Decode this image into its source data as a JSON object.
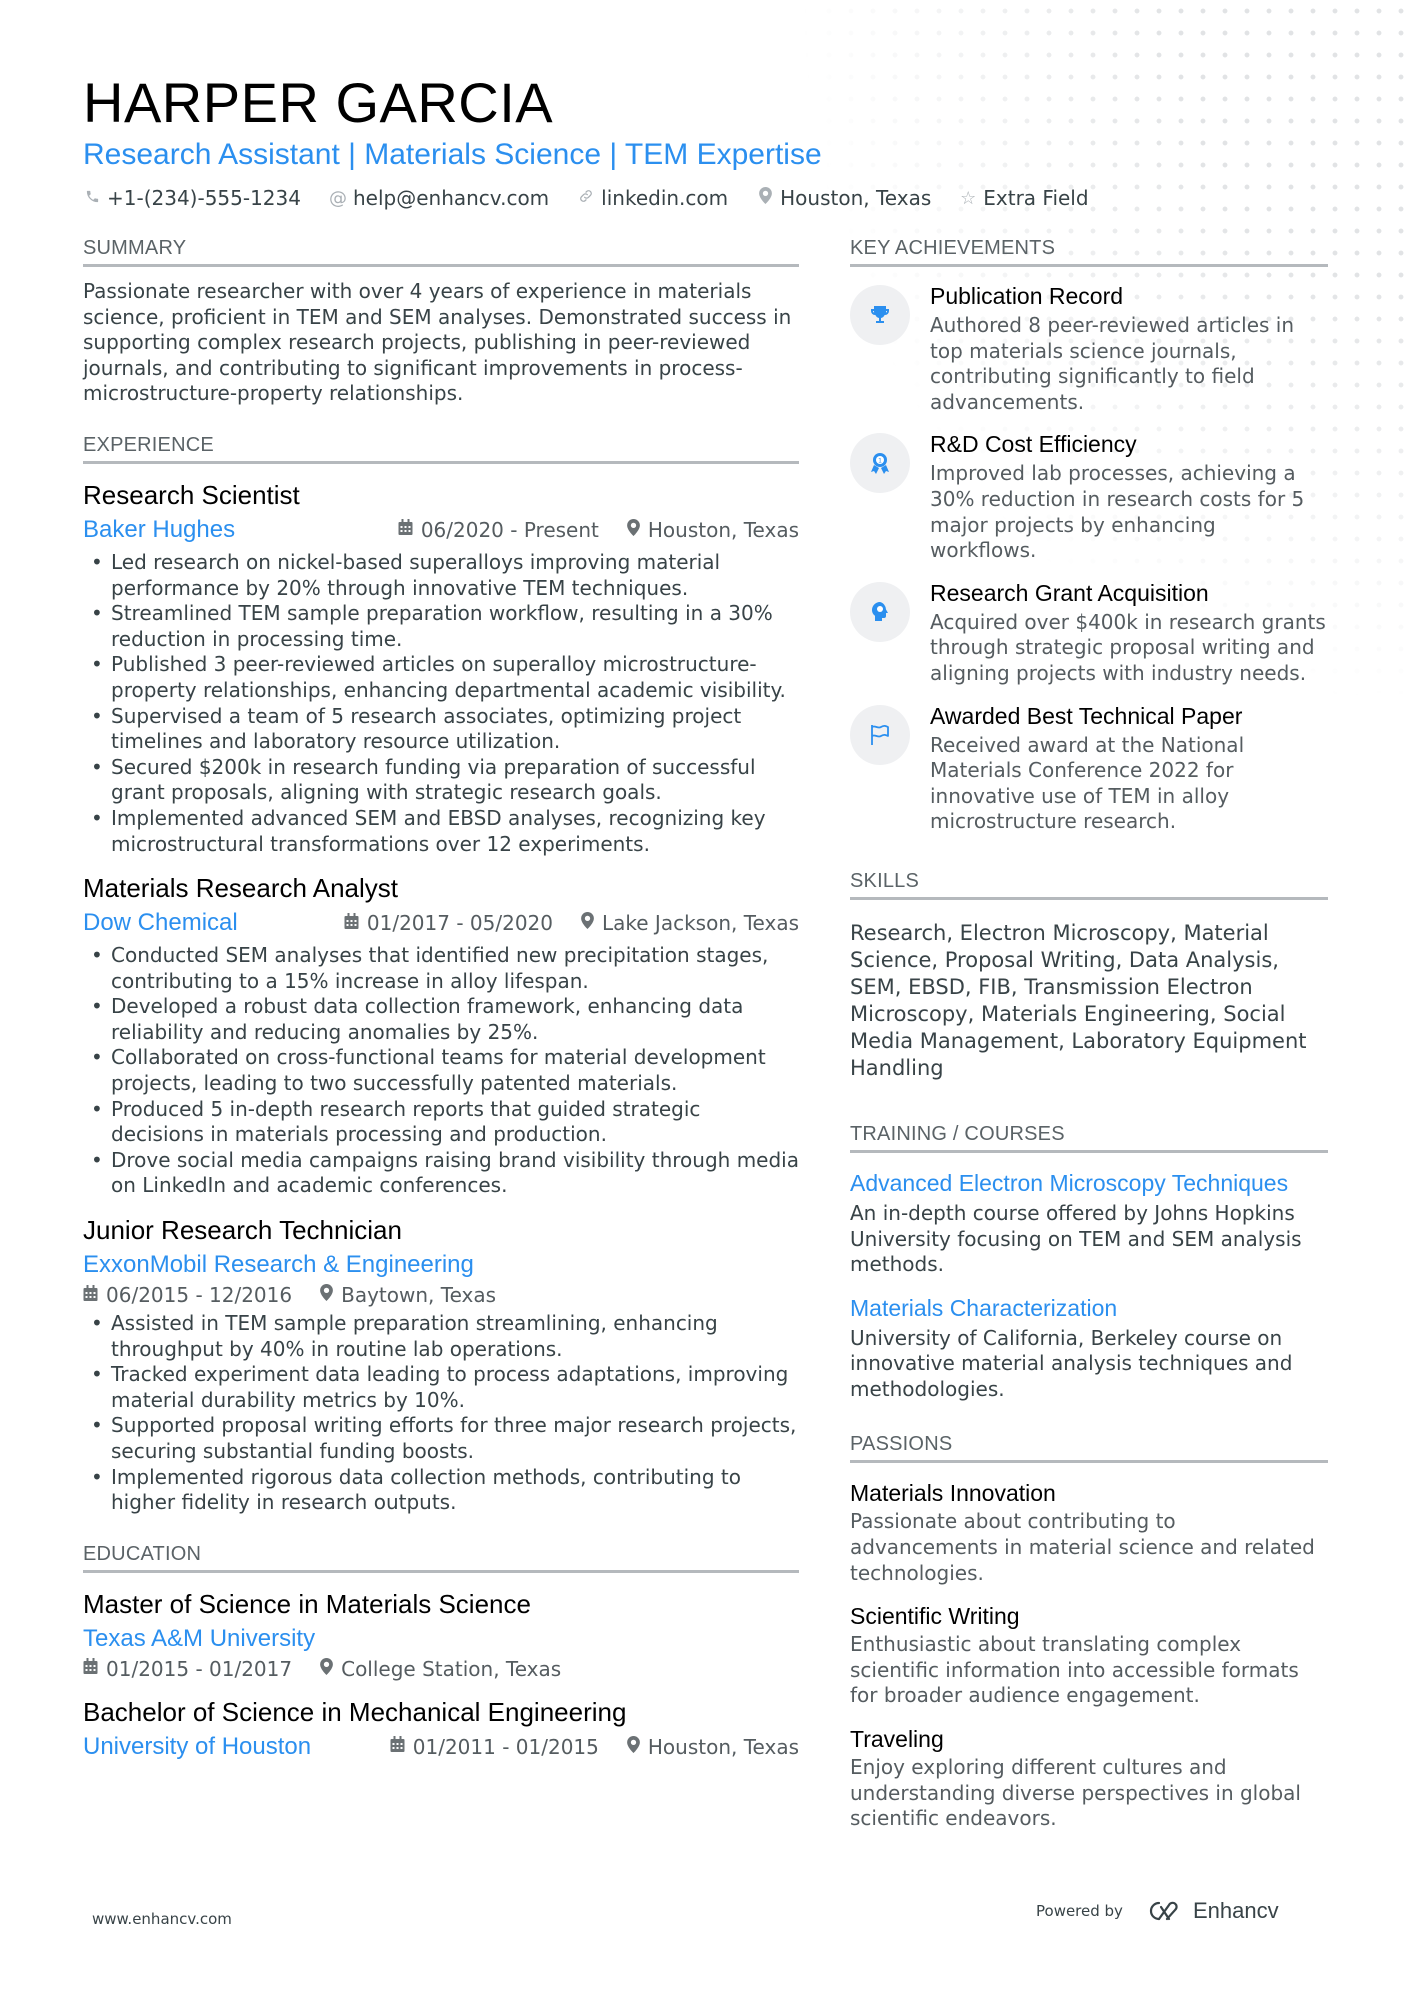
{
  "header": {
    "name": "HARPER GARCIA",
    "title": "Research Assistant | Materials Science | TEM Expertise",
    "contacts": [
      {
        "icon": "phone-icon",
        "glyph": "✆",
        "text": "+1-(234)-555-1234"
      },
      {
        "icon": "at-icon",
        "glyph": "@",
        "text": "help@enhancv.com"
      },
      {
        "icon": "link-icon",
        "glyph": "🔗︎",
        "text": "linkedin.com"
      },
      {
        "icon": "location-pin-icon",
        "glyph": "⚲",
        "text": "Houston, Texas"
      },
      {
        "icon": "star-icon",
        "glyph": "☆",
        "text": "Extra Field"
      }
    ]
  },
  "summary": {
    "heading": "SUMMARY",
    "text": "Passionate researcher with over 4 years of experience in materials science, proficient in TEM and SEM analyses. Demonstrated success in supporting complex research projects, publishing in peer-reviewed journals, and contributing to significant improvements in process-microstructure-property relationships."
  },
  "experience": {
    "heading": "EXPERIENCE",
    "jobs": [
      {
        "title": "Research Scientist",
        "company": "Baker Hughes",
        "dates": "06/2020 - Present",
        "location": "Houston, Texas",
        "bullets": [
          "Led research on nickel-based superalloys improving material performance by 20% through innovative TEM techniques.",
          "Streamlined TEM sample preparation workflow, resulting in a 30% reduction in processing time.",
          "Published 3 peer-reviewed articles on superalloy microstructure-property relationships, enhancing departmental academic visibility.",
          "Supervised a team of 5 research associates, optimizing project timelines and laboratory resource utilization.",
          "Secured $200k in research funding via preparation of successful grant proposals, aligning with strategic research goals.",
          "Implemented advanced SEM and EBSD analyses, recognizing key microstructural transformations over 12 experiments."
        ]
      },
      {
        "title": "Materials Research Analyst",
        "company": "Dow Chemical",
        "dates": "01/2017 - 05/2020",
        "location": "Lake Jackson, Texas",
        "bullets": [
          "Conducted SEM analyses that identified new precipitation stages, contributing to a 15% increase in alloy lifespan.",
          "Developed a robust data collection framework, enhancing data reliability and reducing anomalies by 25%.",
          "Collaborated on cross-functional teams for material development projects, leading to two successfully patented materials.",
          "Produced 5 in-depth research reports that guided strategic decisions in materials processing and production.",
          "Drove social media campaigns raising brand visibility through media on LinkedIn and academic conferences."
        ]
      },
      {
        "title": "Junior Research Technician",
        "company": "ExxonMobil Research & Engineering",
        "dates": "06/2015 - 12/2016",
        "location": "Baytown, Texas",
        "bullets": [
          "Assisted in TEM sample preparation streamlining, enhancing throughput by 40% in routine lab operations.",
          "Tracked experiment data leading to process adaptations, improving material durability metrics by 10%.",
          "Supported proposal writing efforts for three major research projects, securing substantial funding boosts.",
          "Implemented rigorous data collection methods, contributing to higher fidelity in research outputs."
        ]
      }
    ]
  },
  "education": {
    "heading": "EDUCATION",
    "items": [
      {
        "degree": "Master of Science in Materials Science",
        "school": "Texas A&M University",
        "dates": "01/2015 - 01/2017",
        "location": "College Station, Texas"
      },
      {
        "degree": "Bachelor of Science in Mechanical Engineering",
        "school": "University of Houston",
        "dates": "01/2011 - 01/2015",
        "location": "Houston, Texas"
      }
    ]
  },
  "achievements": {
    "heading": "KEY ACHIEVEMENTS",
    "items": [
      {
        "icon": "trophy-icon",
        "title": "Publication Record",
        "desc": "Authored 8 peer-reviewed articles in top materials science journals, contributing significantly to field advancements."
      },
      {
        "icon": "award-ribbon-icon",
        "title": "R&D Cost Efficiency",
        "desc": "Improved lab processes, achieving a 30% reduction in research costs for 5 major projects by enhancing workflows."
      },
      {
        "icon": "head-lightbulb-icon",
        "title": "Research Grant Acquisition",
        "desc": "Acquired over $400k in research grants through strategic proposal writing and aligning projects with industry needs."
      },
      {
        "icon": "flag-icon",
        "title": "Awarded Best Technical Paper",
        "desc": "Received award at the National Materials Conference 2022 for innovative use of TEM in alloy microstructure research."
      }
    ]
  },
  "skills": {
    "heading": "SKILLS",
    "text": "Research, Electron Microscopy, Material Science, Proposal Writing, Data Analysis, SEM, EBSD, FIB, Transmission Electron Microscopy, Materials Engineering, Social Media Management, Laboratory Equipment Handling"
  },
  "training": {
    "heading": "TRAINING / COURSES",
    "items": [
      {
        "title": "Advanced Electron Microscopy Techniques",
        "desc": "An in-depth course offered by Johns Hopkins University focusing on TEM and SEM analysis methods."
      },
      {
        "title": "Materials Characterization",
        "desc": "University of California, Berkeley course on innovative material analysis techniques and methodologies."
      }
    ]
  },
  "passions": {
    "heading": "PASSIONS",
    "items": [
      {
        "title": "Materials Innovation",
        "desc": "Passionate about contributing to advancements in material science and related technologies."
      },
      {
        "title": "Scientific Writing",
        "desc": "Enthusiastic about translating complex scientific information into accessible formats for broader audience engagement."
      },
      {
        "title": "Traveling",
        "desc": "Enjoy exploring different cultures and understanding diverse perspectives in global scientific endeavors."
      }
    ]
  },
  "footer": {
    "website": "www.enhancv.com",
    "powered_by": "Powered by",
    "brand": "Enhancv"
  },
  "colors": {
    "accent": "#2b8fef",
    "text": "#384347",
    "heading_rule": "#b5b9bd"
  }
}
